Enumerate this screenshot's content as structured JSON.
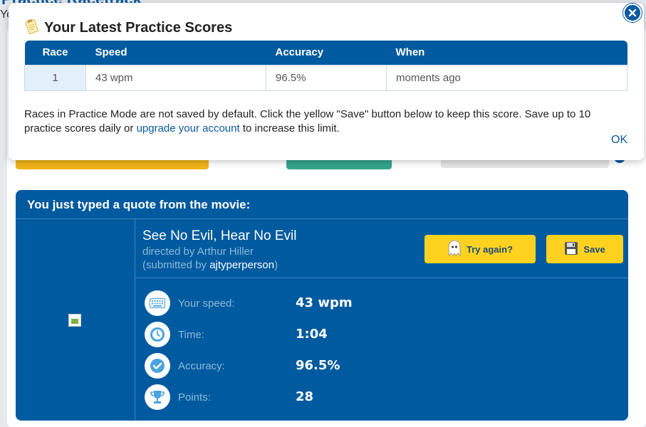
{
  "background": {
    "heading": "Practice Racetrack",
    "subtext": "Yo"
  },
  "modal": {
    "title": "Your Latest Practice Scores",
    "table": {
      "headers": [
        "Race",
        "Speed",
        "Accuracy",
        "When"
      ],
      "rows": [
        {
          "race": "1",
          "speed": "43 wpm",
          "accuracy": "96.5%",
          "when": "moments ago"
        }
      ]
    },
    "message_part1": "Races in Practice Mode are not saved by default. Click the yellow \"Save\" button below to keep this score. Save up to 10 practice scores daily or ",
    "message_link": "upgrade your account",
    "message_part2": " to increase this limit.",
    "ok_label": "OK"
  },
  "result": {
    "title": "You just typed a quote from the movie:",
    "movie_title": "See No Evil, Hear No Evil",
    "directed_by": "directed by Arthur Hiller",
    "submitted_prefix": "(submitted by ",
    "submitted_user": "ajtyperperson",
    "submitted_suffix": ")",
    "try_again_label": "Try again?",
    "save_label": "Save",
    "stats": [
      {
        "label": "Your speed:",
        "value": "43 wpm",
        "icon": "keyboard-icon"
      },
      {
        "label": "Time:",
        "value": "1:04",
        "icon": "clock-icon"
      },
      {
        "label": "Accuracy:",
        "value": "96.5%",
        "icon": "check-icon"
      },
      {
        "label": "Points:",
        "value": "28",
        "icon": "trophy-icon"
      }
    ]
  },
  "colors": {
    "primary_blue": "#005a9f",
    "accent_yellow": "#ffd21f",
    "link_blue": "#0b5aa0"
  }
}
